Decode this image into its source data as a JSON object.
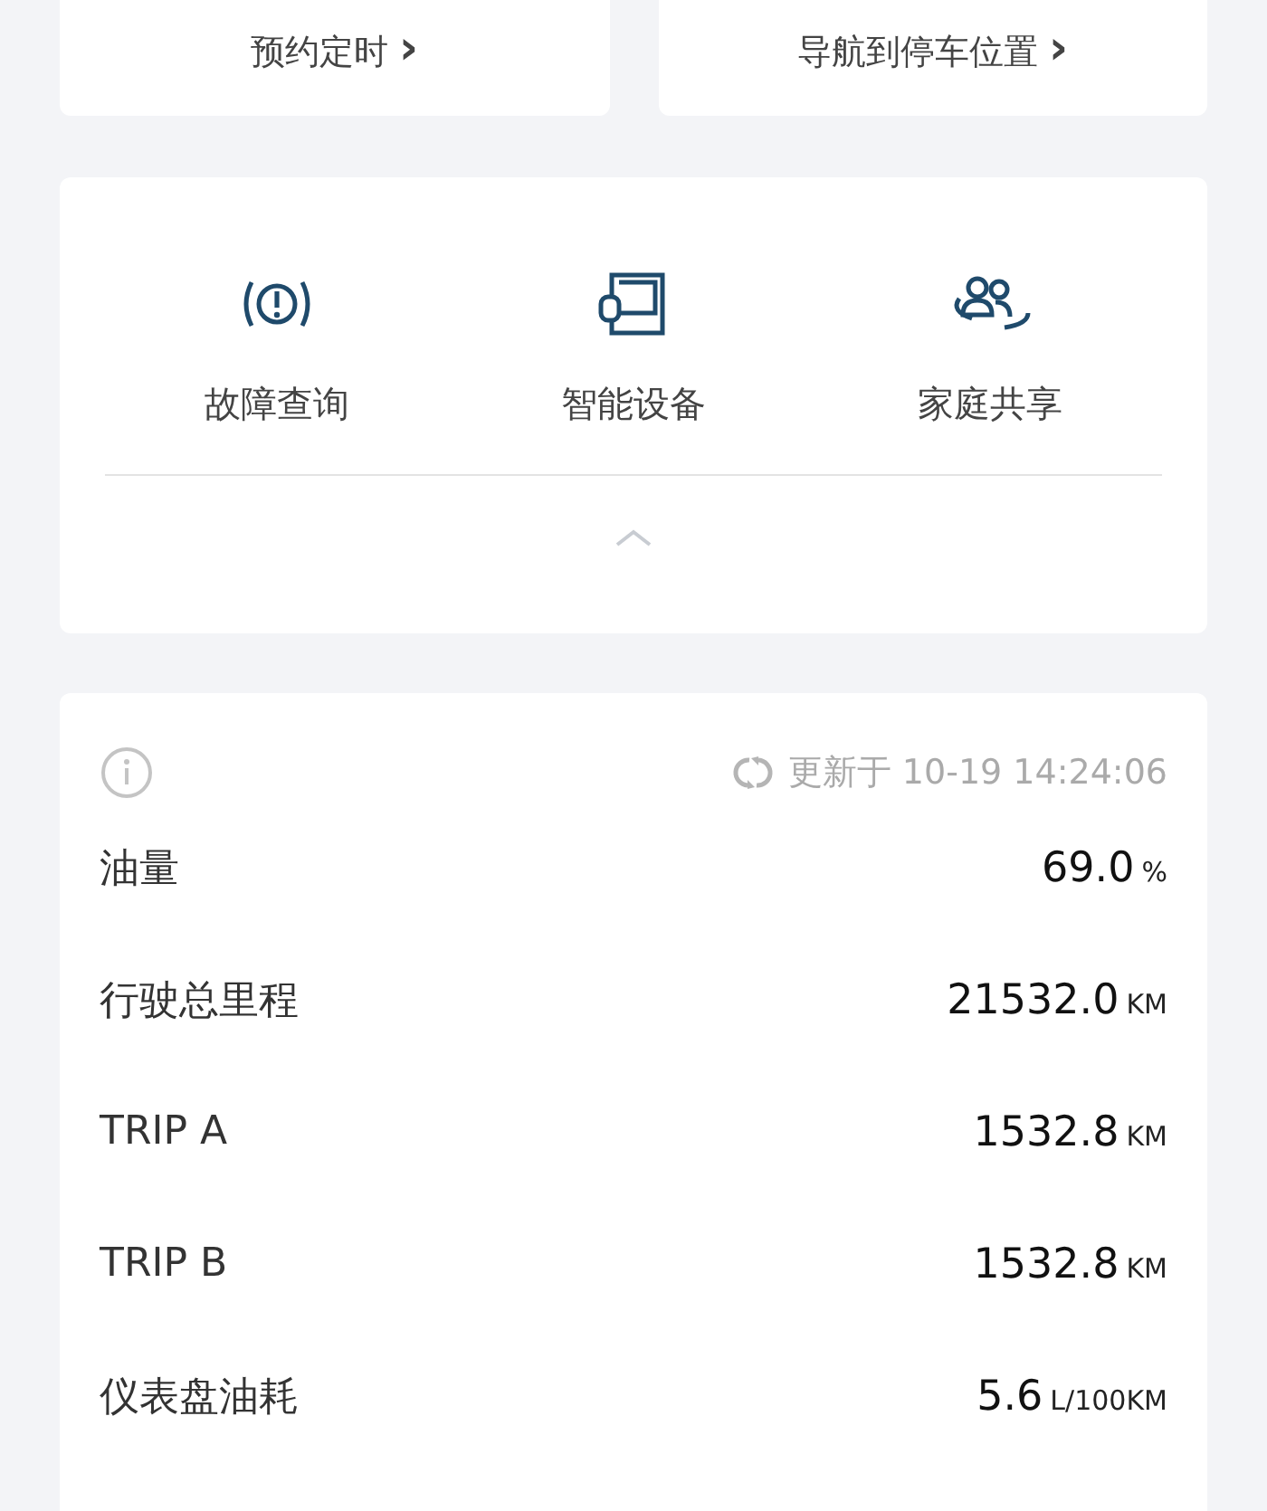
{
  "top_links": [
    {
      "label": "预约定时",
      "arrow": "›"
    },
    {
      "label": "导航到停车位置",
      "arrow": "›"
    }
  ],
  "tiles": [
    {
      "label": "故障查询"
    },
    {
      "label": "智能设备"
    },
    {
      "label": "家庭共享"
    }
  ],
  "collapse": {
    "expanded": true
  },
  "status": {
    "updated": "更新于 10-19 14:24:06"
  },
  "stats": [
    {
      "label": "油量",
      "value": "69.0",
      "unit": "%"
    },
    {
      "label": "行驶总里程",
      "value": "21532.0",
      "unit": "KM"
    },
    {
      "label": "TRIP A",
      "value": "1532.8",
      "unit": "KM"
    },
    {
      "label": "TRIP B",
      "value": "1532.8",
      "unit": "KM"
    },
    {
      "label": "仪表盘油耗",
      "value": "5.6",
      "unit": "L/100KM"
    }
  ]
}
